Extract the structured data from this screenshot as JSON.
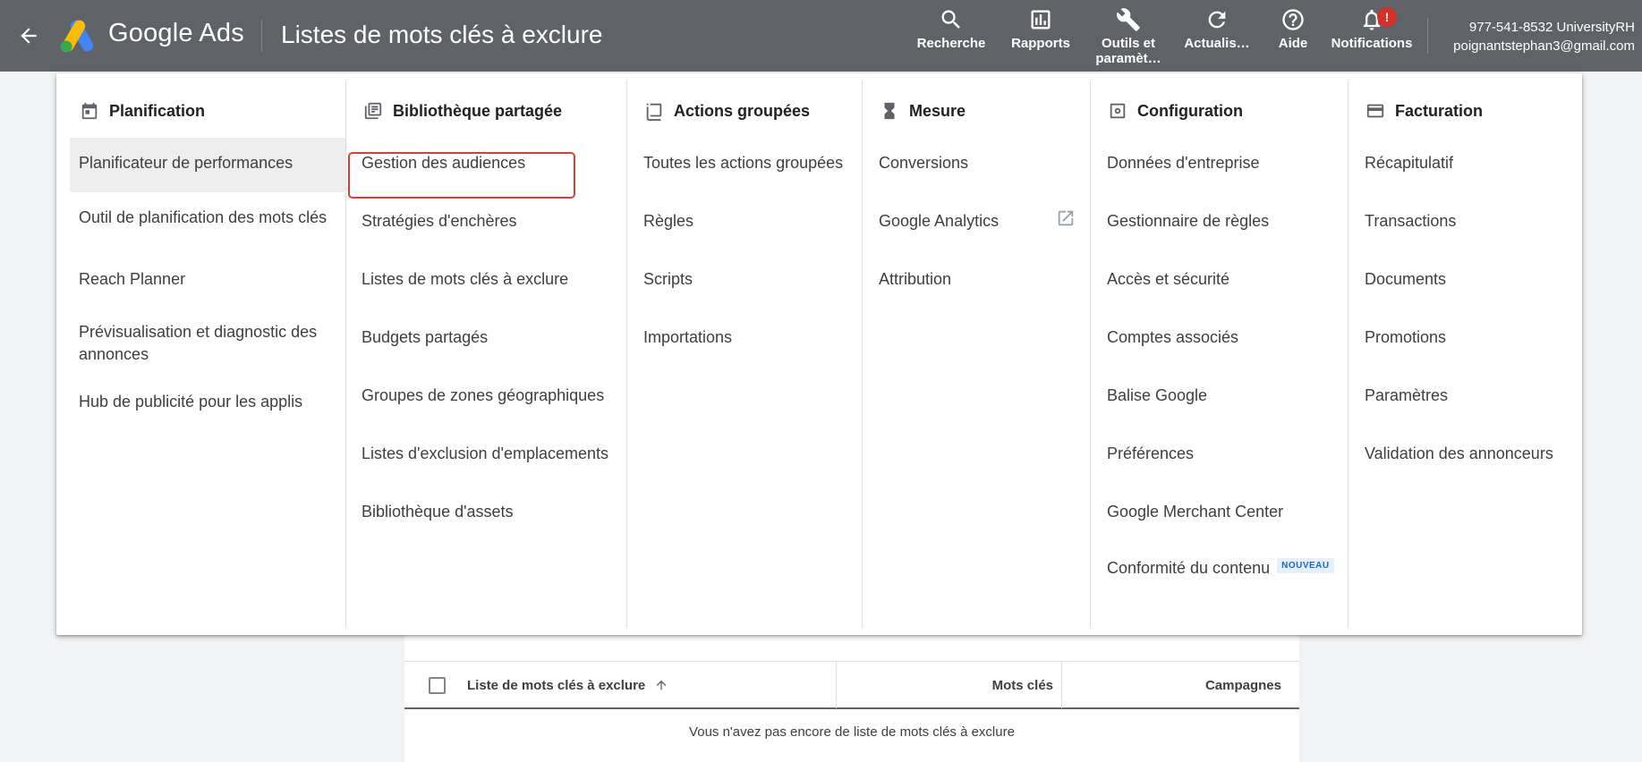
{
  "header": {
    "brand_google": "Google",
    "brand_ads": "Ads",
    "page_title": "Listes de mots clés à exclure",
    "tools": [
      {
        "label": "Recherche",
        "icon": "search-icon"
      },
      {
        "label": "Rapports",
        "icon": "bar-chart-icon"
      },
      {
        "label": "Outils et paramèt…",
        "icon": "wrench-icon"
      },
      {
        "label": "Actualis…",
        "icon": "refresh-icon"
      },
      {
        "label": "Aide",
        "icon": "help-icon"
      },
      {
        "label": "Notifications",
        "icon": "bell-icon",
        "badge": "!"
      }
    ],
    "account": {
      "id_name": "977-541-8532 UniversityRH",
      "email": "poignantstephan3@gmail.com"
    }
  },
  "menu": {
    "columns": [
      {
        "title": "Planification",
        "icon": "calendar-icon",
        "items": [
          {
            "label": "Planificateur de performances",
            "active": true
          },
          {
            "label": "Outil de planification des mots clés"
          },
          {
            "label": "Reach Planner"
          },
          {
            "label": "Prévisualisation et diagnostic des annonces"
          },
          {
            "label": "Hub de publicité pour les applis"
          }
        ]
      },
      {
        "title": "Bibliothèque partagée",
        "icon": "library-icon",
        "items": [
          {
            "label": "Gestion des audiences",
            "highlighted": true
          },
          {
            "label": "Stratégies d'enchères"
          },
          {
            "label": "Listes de mots clés à exclure"
          },
          {
            "label": "Budgets partagés"
          },
          {
            "label": "Groupes de zones géographiques"
          },
          {
            "label": "Listes d'exclusion d'emplacements"
          },
          {
            "label": "Bibliothèque d'assets"
          }
        ]
      },
      {
        "title": "Actions groupées",
        "icon": "copy-icon",
        "items": [
          {
            "label": "Toutes les actions groupées"
          },
          {
            "label": "Règles"
          },
          {
            "label": "Scripts"
          },
          {
            "label": "Importations"
          }
        ]
      },
      {
        "title": "Mesure",
        "icon": "hourglass-icon",
        "items": [
          {
            "label": "Conversions"
          },
          {
            "label": "Google Analytics",
            "external": true
          },
          {
            "label": "Attribution"
          }
        ]
      },
      {
        "title": "Configuration",
        "icon": "settings-icon",
        "items": [
          {
            "label": "Données d'entreprise"
          },
          {
            "label": "Gestionnaire de règles"
          },
          {
            "label": "Accès et sécurité"
          },
          {
            "label": "Comptes associés"
          },
          {
            "label": "Balise Google"
          },
          {
            "label": "Préférences"
          },
          {
            "label": "Google Merchant Center"
          },
          {
            "label": "Conformité du contenu",
            "badge": "NOUVEAU"
          }
        ]
      },
      {
        "title": "Facturation",
        "icon": "credit-card-icon",
        "items": [
          {
            "label": "Récapitulatif"
          },
          {
            "label": "Transactions"
          },
          {
            "label": "Documents"
          },
          {
            "label": "Promotions"
          },
          {
            "label": "Paramètres"
          },
          {
            "label": "Validation des annonceurs"
          }
        ]
      }
    ]
  },
  "table": {
    "columns": [
      "Liste de mots clés à exclure",
      "Mots clés",
      "Campagnes"
    ],
    "empty_message": "Vous n'avez pas encore de liste de mots clés à exclure"
  }
}
